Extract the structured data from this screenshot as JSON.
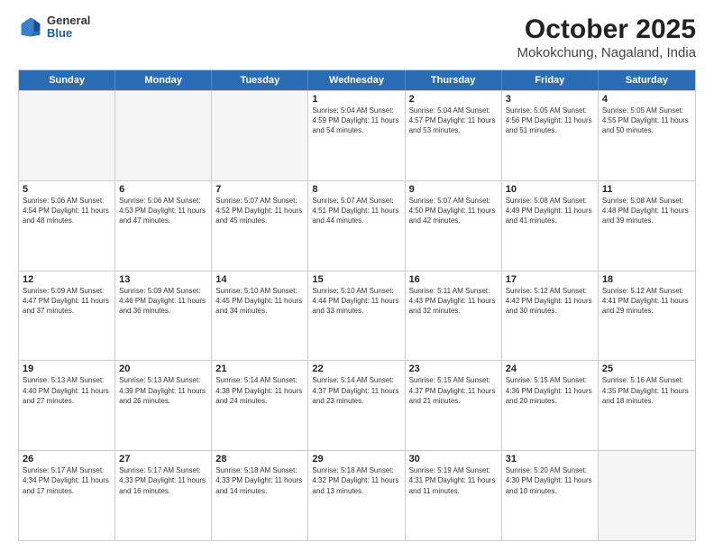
{
  "logo": {
    "general": "General",
    "blue": "Blue"
  },
  "title": "October 2025",
  "subtitle": "Mokokchung, Nagaland, India",
  "weekdays": [
    "Sunday",
    "Monday",
    "Tuesday",
    "Wednesday",
    "Thursday",
    "Friday",
    "Saturday"
  ],
  "rows": [
    [
      {
        "day": "",
        "info": "",
        "empty": true
      },
      {
        "day": "",
        "info": "",
        "empty": true
      },
      {
        "day": "",
        "info": "",
        "empty": true
      },
      {
        "day": "1",
        "info": "Sunrise: 5:04 AM\nSunset: 4:59 PM\nDaylight: 11 hours\nand 54 minutes."
      },
      {
        "day": "2",
        "info": "Sunrise: 5:04 AM\nSunset: 4:57 PM\nDaylight: 11 hours\nand 53 minutes."
      },
      {
        "day": "3",
        "info": "Sunrise: 5:05 AM\nSunset: 4:56 PM\nDaylight: 11 hours\nand 51 minutes."
      },
      {
        "day": "4",
        "info": "Sunrise: 5:05 AM\nSunset: 4:55 PM\nDaylight: 11 hours\nand 50 minutes."
      }
    ],
    [
      {
        "day": "5",
        "info": "Sunrise: 5:06 AM\nSunset: 4:54 PM\nDaylight: 11 hours\nand 48 minutes."
      },
      {
        "day": "6",
        "info": "Sunrise: 5:06 AM\nSunset: 4:53 PM\nDaylight: 11 hours\nand 47 minutes."
      },
      {
        "day": "7",
        "info": "Sunrise: 5:07 AM\nSunset: 4:52 PM\nDaylight: 11 hours\nand 45 minutes."
      },
      {
        "day": "8",
        "info": "Sunrise: 5:07 AM\nSunset: 4:51 PM\nDaylight: 11 hours\nand 44 minutes."
      },
      {
        "day": "9",
        "info": "Sunrise: 5:07 AM\nSunset: 4:50 PM\nDaylight: 11 hours\nand 42 minutes."
      },
      {
        "day": "10",
        "info": "Sunrise: 5:08 AM\nSunset: 4:49 PM\nDaylight: 11 hours\nand 41 minutes."
      },
      {
        "day": "11",
        "info": "Sunrise: 5:08 AM\nSunset: 4:48 PM\nDaylight: 11 hours\nand 39 minutes."
      }
    ],
    [
      {
        "day": "12",
        "info": "Sunrise: 5:09 AM\nSunset: 4:47 PM\nDaylight: 11 hours\nand 37 minutes."
      },
      {
        "day": "13",
        "info": "Sunrise: 5:09 AM\nSunset: 4:46 PM\nDaylight: 11 hours\nand 36 minutes."
      },
      {
        "day": "14",
        "info": "Sunrise: 5:10 AM\nSunset: 4:45 PM\nDaylight: 11 hours\nand 34 minutes."
      },
      {
        "day": "15",
        "info": "Sunrise: 5:10 AM\nSunset: 4:44 PM\nDaylight: 11 hours\nand 33 minutes."
      },
      {
        "day": "16",
        "info": "Sunrise: 5:11 AM\nSunset: 4:43 PM\nDaylight: 11 hours\nand 32 minutes."
      },
      {
        "day": "17",
        "info": "Sunrise: 5:12 AM\nSunset: 4:42 PM\nDaylight: 11 hours\nand 30 minutes."
      },
      {
        "day": "18",
        "info": "Sunrise: 5:12 AM\nSunset: 4:41 PM\nDaylight: 11 hours\nand 29 minutes."
      }
    ],
    [
      {
        "day": "19",
        "info": "Sunrise: 5:13 AM\nSunset: 4:40 PM\nDaylight: 11 hours\nand 27 minutes."
      },
      {
        "day": "20",
        "info": "Sunrise: 5:13 AM\nSunset: 4:39 PM\nDaylight: 11 hours\nand 26 minutes."
      },
      {
        "day": "21",
        "info": "Sunrise: 5:14 AM\nSunset: 4:38 PM\nDaylight: 11 hours\nand 24 minutes."
      },
      {
        "day": "22",
        "info": "Sunrise: 5:14 AM\nSunset: 4:37 PM\nDaylight: 11 hours\nand 23 minutes."
      },
      {
        "day": "23",
        "info": "Sunrise: 5:15 AM\nSunset: 4:37 PM\nDaylight: 11 hours\nand 21 minutes."
      },
      {
        "day": "24",
        "info": "Sunrise: 5:15 AM\nSunset: 4:36 PM\nDaylight: 11 hours\nand 20 minutes."
      },
      {
        "day": "25",
        "info": "Sunrise: 5:16 AM\nSunset: 4:35 PM\nDaylight: 11 hours\nand 18 minutes."
      }
    ],
    [
      {
        "day": "26",
        "info": "Sunrise: 5:17 AM\nSunset: 4:34 PM\nDaylight: 11 hours\nand 17 minutes."
      },
      {
        "day": "27",
        "info": "Sunrise: 5:17 AM\nSunset: 4:33 PM\nDaylight: 11 hours\nand 16 minutes."
      },
      {
        "day": "28",
        "info": "Sunrise: 5:18 AM\nSunset: 4:33 PM\nDaylight: 11 hours\nand 14 minutes."
      },
      {
        "day": "29",
        "info": "Sunrise: 5:18 AM\nSunset: 4:32 PM\nDaylight: 11 hours\nand 13 minutes."
      },
      {
        "day": "30",
        "info": "Sunrise: 5:19 AM\nSunset: 4:31 PM\nDaylight: 11 hours\nand 11 minutes."
      },
      {
        "day": "31",
        "info": "Sunrise: 5:20 AM\nSunset: 4:30 PM\nDaylight: 11 hours\nand 10 minutes."
      },
      {
        "day": "",
        "info": "",
        "empty": true
      }
    ]
  ]
}
